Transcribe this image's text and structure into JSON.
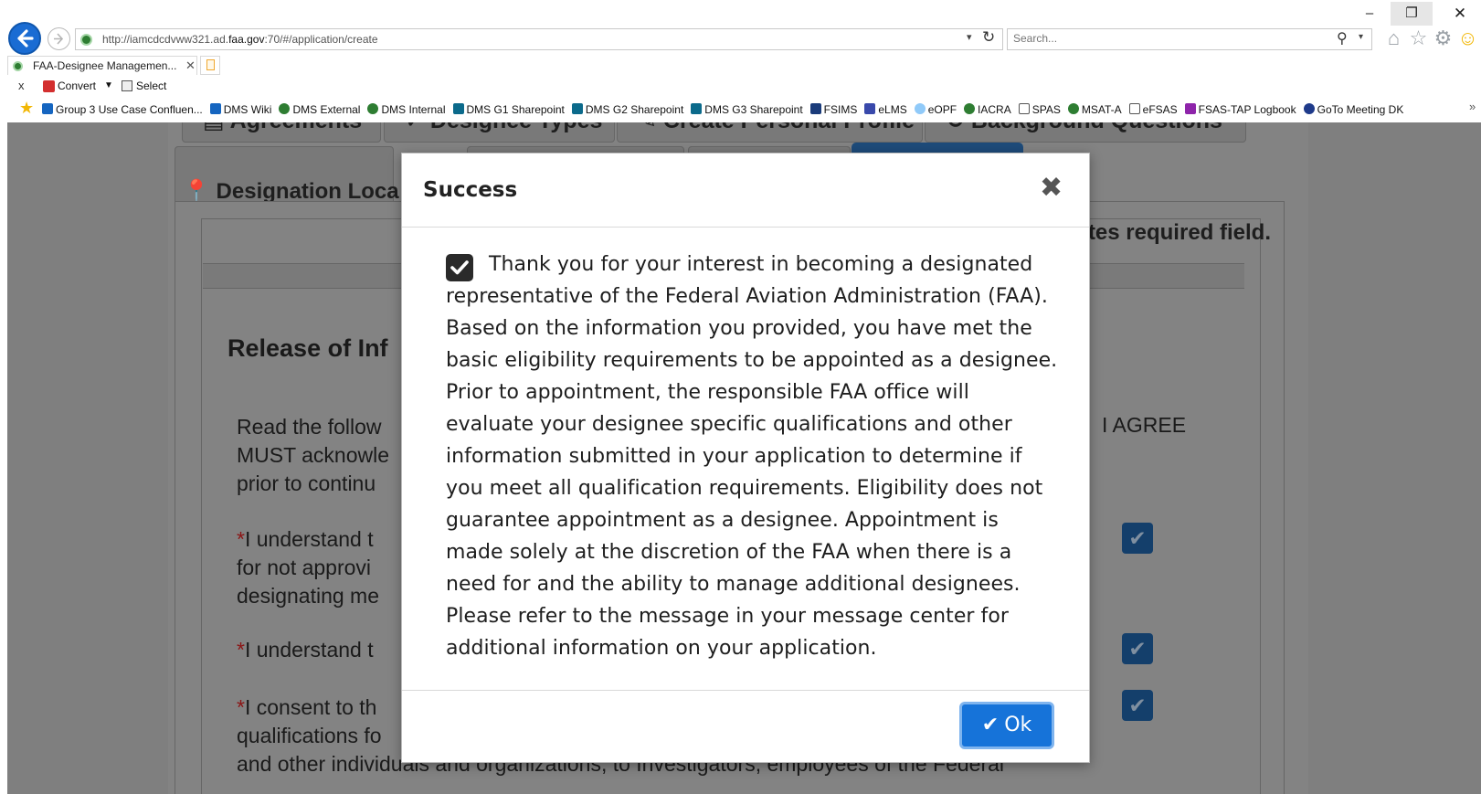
{
  "browser": {
    "url_prefix": "http://iamcdcdvww321.ad.",
    "url_domain": "faa.gov",
    "url_suffix": ":70/#/application/create",
    "search_placeholder": "Search...",
    "tab_title": "FAA-Designee Managemen...",
    "window_min": "–",
    "window_restore": "❐",
    "window_close": "✕"
  },
  "commandbar": {
    "close": "x",
    "convert_label": "Convert",
    "select_label": "Select"
  },
  "favorites": [
    {
      "label": "Group 3 Use Case Confluen...",
      "icon": "conf"
    },
    {
      "label": "DMS Wiki",
      "icon": "conf"
    },
    {
      "label": "DMS External",
      "icon": "glob"
    },
    {
      "label": "DMS Internal",
      "icon": "glob"
    },
    {
      "label": "DMS G1 Sharepoint",
      "icon": "sp"
    },
    {
      "label": "DMS G2 Sharepoint",
      "icon": "sp"
    },
    {
      "label": "DMS G3 Sharepoint",
      "icon": "sp"
    },
    {
      "label": "FSIMS",
      "icon": "fsims"
    },
    {
      "label": "eLMS",
      "icon": "elms"
    },
    {
      "label": "eOPF",
      "icon": "eopf"
    },
    {
      "label": "IACRA",
      "icon": "glob"
    },
    {
      "label": "SPAS",
      "icon": "doc"
    },
    {
      "label": "MSAT-A",
      "icon": "glob"
    },
    {
      "label": "eFSAS",
      "icon": "doc"
    },
    {
      "label": "FSAS-TAP Logbook",
      "icon": "fsas"
    },
    {
      "label": "GoTo Meeting DK",
      "icon": "goto"
    }
  ],
  "page": {
    "tabs_row1": [
      "▤ Agreements",
      "✓ Designee Types",
      "✎ Create Personal Profile",
      "↻ Background Questions"
    ],
    "tab_location": "📍 Designation Loca",
    "required_note": "ates required field.",
    "section_title": "Release of Inf",
    "i_agree": "I AGREE",
    "read_lines": [
      "Read the follow",
      "MUST acknowle",
      "prior to continu"
    ],
    "statement1_lines": [
      "I understand t",
      "for not approvi",
      "designating me"
    ],
    "statement2_lines": [
      "I understand t"
    ],
    "statement3_lines": [
      "I consent to th",
      "qualifications fo",
      "and other individuals and organizations, to Investigators, employees of the Federal"
    ],
    "asterisk": "*"
  },
  "modal": {
    "title": "Success",
    "close_glyph": "✖",
    "message_lines": [
      "Thank you for your interest in becoming a designated",
      "representative of the Federal Aviation Administration (FAA).",
      "Based on the information you provided, you have met the",
      "basic eligibility requirements to be appointed as a designee.",
      "Prior to appointment, the responsible FAA office will",
      "evaluate your designee specific qualifications and other",
      "information submitted in your application to determine if",
      "you meet all qualification requirements. Eligibility does not",
      "guarantee appointment as a designee. Appointment is",
      "made solely at the discretion of the FAA when there is a",
      "need for and the ability to manage additional designees.",
      "Please refer to the message in your message center for",
      "additional information on your application."
    ],
    "ok_label": "Ok",
    "ok_icon": "✔"
  },
  "colors": {
    "primary": "#1673d9",
    "overlay": "#7f7f7f",
    "checkbox_dark": "#143f6b"
  }
}
